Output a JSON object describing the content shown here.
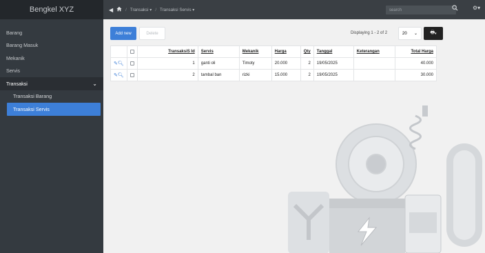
{
  "app": {
    "title": "Bengkel XYZ"
  },
  "sidebar": {
    "items": [
      {
        "label": "Barang"
      },
      {
        "label": "Barang Masuk"
      },
      {
        "label": "Mekanik"
      },
      {
        "label": "Servis"
      },
      {
        "label": "Transaksi"
      }
    ],
    "submenu": [
      {
        "label": "Transaksi Barang"
      },
      {
        "label": "Transaksi Servis"
      }
    ]
  },
  "topbar": {
    "breadcrumb": [
      "Transaksi",
      "Transaksi Servis"
    ],
    "search_placeholder": "search"
  },
  "toolbar": {
    "add_label": "Add new",
    "delete_label": "Delete",
    "paging_text": "Displaying 1 - 2 of 2",
    "page_size": "20"
  },
  "table": {
    "columns": [
      "TransaksiS Id",
      "Servis",
      "Mekanik",
      "Harga",
      "Qty",
      "Tanggal",
      "Keterangan",
      "Total Harga"
    ],
    "rows": [
      [
        "1",
        "ganti oli",
        "Timoty",
        "20.000",
        "2",
        "19/05/2025",
        "",
        "40.000"
      ],
      [
        "2",
        "tambal ban",
        "rizki",
        "15.000",
        "2",
        "19/05/2025",
        "",
        "30.000"
      ]
    ]
  },
  "icons": {
    "home": "home-icon",
    "edit": "pencil-icon",
    "view": "magnifier-icon",
    "settings": "gear-icon",
    "export": "print-icon"
  },
  "colors": {
    "accent": "#3d7fd8",
    "sidebar": "#343a40",
    "topbar": "#3a3f44"
  }
}
